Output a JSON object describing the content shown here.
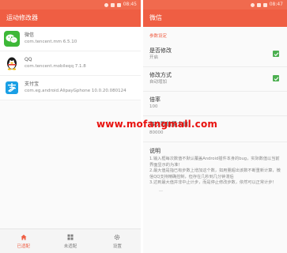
{
  "left": {
    "status_time": "08:45",
    "title": "运动修改器",
    "apps": [
      {
        "name": "微信",
        "package": "com.tencent.mm 6.5.10",
        "icon": "wechat-icon"
      },
      {
        "name": "QQ",
        "package": "com.tencent.mobileqq 7.1.8",
        "icon": "qq-penguin-icon"
      },
      {
        "name": "支付宝",
        "package": "com.eg.android.AlipayGphone 10.0.20.080124",
        "icon": "alipay-icon"
      }
    ],
    "nav": [
      {
        "label": "已适配",
        "icon": "home-icon",
        "active": true
      },
      {
        "label": "未适配",
        "icon": "grid-icon",
        "active": false
      },
      {
        "label": "设置",
        "icon": "settings-gear-icon",
        "active": false
      }
    ]
  },
  "right": {
    "status_time": "08:47",
    "title": "微信",
    "section": "参数设定",
    "settings": {
      "enable_title": "是否修改",
      "enable_value": "开启",
      "mode_title": "修改方式",
      "mode_value": "自动增加",
      "multiplier_title": "倍率",
      "multiplier_value": "100",
      "max_title": "每次数值最大值",
      "max_value": "80000"
    },
    "description_title": "说明",
    "description_body": "1.输入框每次数值不默认覆盖Android插件本身的bug，实际数值以当前界面显示的为准！\n2.最大值是指已有步数上增加这个数，如用量超出该数不断重新计算，微信QQ支持精确控制，但存在几秒到几分钟滞后\n3.达到最大值并非中止计步，而是停止修改步数，依然可以正常计步！",
    "more": "..."
  },
  "watermark": "www.mofangmall.com",
  "colors": {
    "accent": "#ef5e43",
    "statusbar": "#f06a4e",
    "check": "#4caf50",
    "watermark": "#e8110e"
  }
}
